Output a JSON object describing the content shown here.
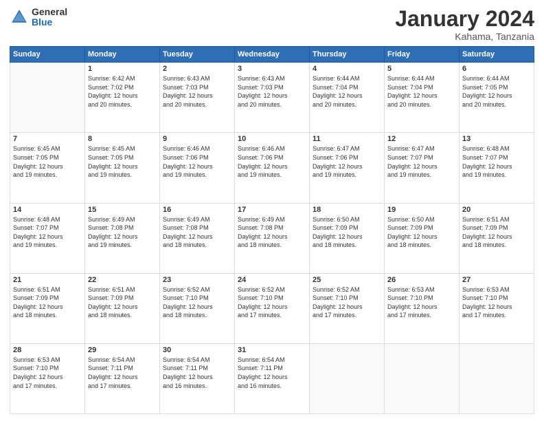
{
  "header": {
    "logo_general": "General",
    "logo_blue": "Blue",
    "month": "January 2024",
    "location": "Kahama, Tanzania"
  },
  "weekdays": [
    "Sunday",
    "Monday",
    "Tuesday",
    "Wednesday",
    "Thursday",
    "Friday",
    "Saturday"
  ],
  "weeks": [
    [
      {
        "day": "",
        "sunrise": "",
        "sunset": "",
        "daylight": ""
      },
      {
        "day": "1",
        "sunrise": "Sunrise: 6:42 AM",
        "sunset": "Sunset: 7:02 PM",
        "daylight": "Daylight: 12 hours and 20 minutes."
      },
      {
        "day": "2",
        "sunrise": "Sunrise: 6:43 AM",
        "sunset": "Sunset: 7:03 PM",
        "daylight": "Daylight: 12 hours and 20 minutes."
      },
      {
        "day": "3",
        "sunrise": "Sunrise: 6:43 AM",
        "sunset": "Sunset: 7:03 PM",
        "daylight": "Daylight: 12 hours and 20 minutes."
      },
      {
        "day": "4",
        "sunrise": "Sunrise: 6:44 AM",
        "sunset": "Sunset: 7:04 PM",
        "daylight": "Daylight: 12 hours and 20 minutes."
      },
      {
        "day": "5",
        "sunrise": "Sunrise: 6:44 AM",
        "sunset": "Sunset: 7:04 PM",
        "daylight": "Daylight: 12 hours and 20 minutes."
      },
      {
        "day": "6",
        "sunrise": "Sunrise: 6:44 AM",
        "sunset": "Sunset: 7:05 PM",
        "daylight": "Daylight: 12 hours and 20 minutes."
      }
    ],
    [
      {
        "day": "7",
        "sunrise": "Sunrise: 6:45 AM",
        "sunset": "Sunset: 7:05 PM",
        "daylight": "Daylight: 12 hours and 19 minutes."
      },
      {
        "day": "8",
        "sunrise": "Sunrise: 6:45 AM",
        "sunset": "Sunset: 7:05 PM",
        "daylight": "Daylight: 12 hours and 19 minutes."
      },
      {
        "day": "9",
        "sunrise": "Sunrise: 6:46 AM",
        "sunset": "Sunset: 7:06 PM",
        "daylight": "Daylight: 12 hours and 19 minutes."
      },
      {
        "day": "10",
        "sunrise": "Sunrise: 6:46 AM",
        "sunset": "Sunset: 7:06 PM",
        "daylight": "Daylight: 12 hours and 19 minutes."
      },
      {
        "day": "11",
        "sunrise": "Sunrise: 6:47 AM",
        "sunset": "Sunset: 7:06 PM",
        "daylight": "Daylight: 12 hours and 19 minutes."
      },
      {
        "day": "12",
        "sunrise": "Sunrise: 6:47 AM",
        "sunset": "Sunset: 7:07 PM",
        "daylight": "Daylight: 12 hours and 19 minutes."
      },
      {
        "day": "13",
        "sunrise": "Sunrise: 6:48 AM",
        "sunset": "Sunset: 7:07 PM",
        "daylight": "Daylight: 12 hours and 19 minutes."
      }
    ],
    [
      {
        "day": "14",
        "sunrise": "Sunrise: 6:48 AM",
        "sunset": "Sunset: 7:07 PM",
        "daylight": "Daylight: 12 hours and 19 minutes."
      },
      {
        "day": "15",
        "sunrise": "Sunrise: 6:49 AM",
        "sunset": "Sunset: 7:08 PM",
        "daylight": "Daylight: 12 hours and 19 minutes."
      },
      {
        "day": "16",
        "sunrise": "Sunrise: 6:49 AM",
        "sunset": "Sunset: 7:08 PM",
        "daylight": "Daylight: 12 hours and 18 minutes."
      },
      {
        "day": "17",
        "sunrise": "Sunrise: 6:49 AM",
        "sunset": "Sunset: 7:08 PM",
        "daylight": "Daylight: 12 hours and 18 minutes."
      },
      {
        "day": "18",
        "sunrise": "Sunrise: 6:50 AM",
        "sunset": "Sunset: 7:09 PM",
        "daylight": "Daylight: 12 hours and 18 minutes."
      },
      {
        "day": "19",
        "sunrise": "Sunrise: 6:50 AM",
        "sunset": "Sunset: 7:09 PM",
        "daylight": "Daylight: 12 hours and 18 minutes."
      },
      {
        "day": "20",
        "sunrise": "Sunrise: 6:51 AM",
        "sunset": "Sunset: 7:09 PM",
        "daylight": "Daylight: 12 hours and 18 minutes."
      }
    ],
    [
      {
        "day": "21",
        "sunrise": "Sunrise: 6:51 AM",
        "sunset": "Sunset: 7:09 PM",
        "daylight": "Daylight: 12 hours and 18 minutes."
      },
      {
        "day": "22",
        "sunrise": "Sunrise: 6:51 AM",
        "sunset": "Sunset: 7:09 PM",
        "daylight": "Daylight: 12 hours and 18 minutes."
      },
      {
        "day": "23",
        "sunrise": "Sunrise: 6:52 AM",
        "sunset": "Sunset: 7:10 PM",
        "daylight": "Daylight: 12 hours and 18 minutes."
      },
      {
        "day": "24",
        "sunrise": "Sunrise: 6:52 AM",
        "sunset": "Sunset: 7:10 PM",
        "daylight": "Daylight: 12 hours and 17 minutes."
      },
      {
        "day": "25",
        "sunrise": "Sunrise: 6:52 AM",
        "sunset": "Sunset: 7:10 PM",
        "daylight": "Daylight: 12 hours and 17 minutes."
      },
      {
        "day": "26",
        "sunrise": "Sunrise: 6:53 AM",
        "sunset": "Sunset: 7:10 PM",
        "daylight": "Daylight: 12 hours and 17 minutes."
      },
      {
        "day": "27",
        "sunrise": "Sunrise: 6:53 AM",
        "sunset": "Sunset: 7:10 PM",
        "daylight": "Daylight: 12 hours and 17 minutes."
      }
    ],
    [
      {
        "day": "28",
        "sunrise": "Sunrise: 6:53 AM",
        "sunset": "Sunset: 7:10 PM",
        "daylight": "Daylight: 12 hours and 17 minutes."
      },
      {
        "day": "29",
        "sunrise": "Sunrise: 6:54 AM",
        "sunset": "Sunset: 7:11 PM",
        "daylight": "Daylight: 12 hours and 17 minutes."
      },
      {
        "day": "30",
        "sunrise": "Sunrise: 6:54 AM",
        "sunset": "Sunset: 7:11 PM",
        "daylight": "Daylight: 12 hours and 16 minutes."
      },
      {
        "day": "31",
        "sunrise": "Sunrise: 6:54 AM",
        "sunset": "Sunset: 7:11 PM",
        "daylight": "Daylight: 12 hours and 16 minutes."
      },
      {
        "day": "",
        "sunrise": "",
        "sunset": "",
        "daylight": ""
      },
      {
        "day": "",
        "sunrise": "",
        "sunset": "",
        "daylight": ""
      },
      {
        "day": "",
        "sunrise": "",
        "sunset": "",
        "daylight": ""
      }
    ]
  ]
}
